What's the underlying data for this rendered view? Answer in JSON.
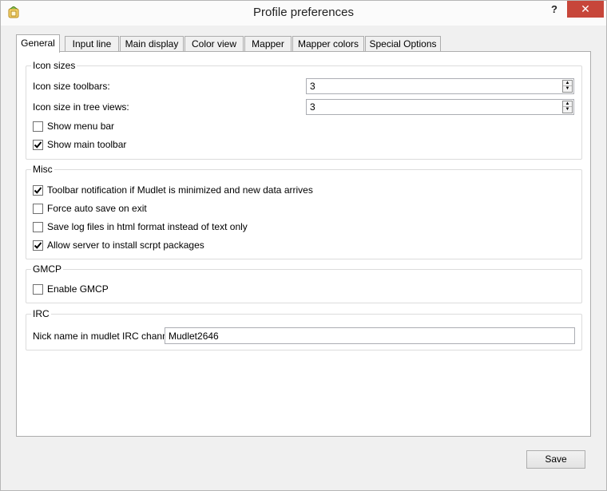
{
  "window": {
    "title": "Profile preferences",
    "help_label": "?",
    "close_label": "✕"
  },
  "tabs": [
    {
      "label": "General",
      "active": true
    },
    {
      "label": "Input line",
      "active": false
    },
    {
      "label": "Main display",
      "active": false
    },
    {
      "label": "Color view",
      "active": false
    },
    {
      "label": "Mapper",
      "active": false
    },
    {
      "label": "Mapper colors",
      "active": false
    },
    {
      "label": "Special Options",
      "active": false
    }
  ],
  "icon_sizes": {
    "title": "Icon sizes",
    "toolbars_label": "Icon size toolbars:",
    "toolbars_value": "3",
    "tree_views_label": "Icon size in tree views:",
    "tree_views_value": "3",
    "show_menu_bar": {
      "label": "Show menu bar",
      "checked": false
    },
    "show_main_toolbar": {
      "label": "Show main toolbar",
      "checked": true
    }
  },
  "misc": {
    "title": "Misc",
    "toolbar_notification": {
      "label": "Toolbar notification if Mudlet is minimized and new data arrives",
      "checked": true
    },
    "force_auto_save": {
      "label": "Force auto save on exit",
      "checked": false
    },
    "save_log_html": {
      "label": "Save log files in html format instead of text only",
      "checked": false
    },
    "allow_server_install": {
      "label": "Allow server to install scrpt packages",
      "checked": true
    }
  },
  "gmcp": {
    "title": "GMCP",
    "enable_gmcp": {
      "label": "Enable GMCP",
      "checked": false
    }
  },
  "irc": {
    "title": "IRC",
    "nick_label": "Nick name in mudlet IRC channel:",
    "nick_value": "Mudlet2646"
  },
  "footer": {
    "save_label": "Save"
  },
  "colors": {
    "close_button": "#c7463a",
    "check_mark": "#000000"
  }
}
